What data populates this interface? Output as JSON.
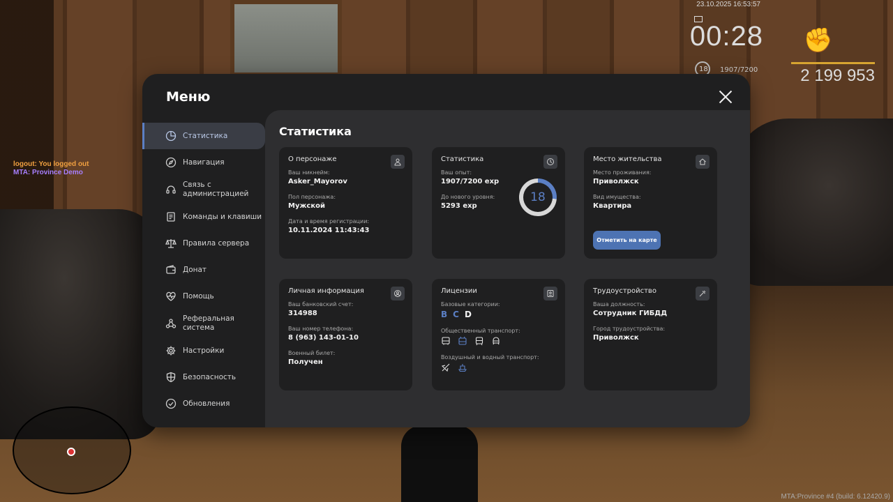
{
  "hud": {
    "datetime": "23.10.2025 16:53:57",
    "timer": "00:28",
    "level": "18",
    "exp": "1907/7200",
    "money": "2 199 953"
  },
  "chat": {
    "line1": "logout: You logged out",
    "line2": "MTA: Province Demo"
  },
  "build_info": "MTA:Province #4 (build: 6.12420.9)",
  "menu": {
    "title": "Меню",
    "sidebar": [
      {
        "label": "Статистика",
        "icon": "pie-chart-icon",
        "active": true
      },
      {
        "label": "Навигация",
        "icon": "compass-icon"
      },
      {
        "label": "Связь с администрацией",
        "icon": "headset-icon"
      },
      {
        "label": "Команды и клавиши",
        "icon": "document-icon"
      },
      {
        "label": "Правила сервера",
        "icon": "scales-icon"
      },
      {
        "label": "Донат",
        "icon": "wallet-icon"
      },
      {
        "label": "Помощь",
        "icon": "heart-pulse-icon"
      },
      {
        "label": "Реферальная система",
        "icon": "network-icon"
      },
      {
        "label": "Настройки",
        "icon": "gear-icon"
      },
      {
        "label": "Безопасность",
        "icon": "shield-icon"
      },
      {
        "label": "Обновления",
        "icon": "check-circle-icon"
      }
    ],
    "content_title": "Статистика",
    "cards": {
      "character": {
        "title": "О персонаже",
        "nickname_label": "Ваш никнейм:",
        "nickname": "Asker_Mayorov",
        "gender_label": "Пол персонажа:",
        "gender": "Мужской",
        "reg_label": "Дата и время регистрации:",
        "reg_date": "10.11.2024 11:43:43"
      },
      "stats": {
        "title": "Статистика",
        "exp_label": "Ваш опыт:",
        "exp": "1907/7200 exp",
        "next_label": "До нового уровня:",
        "next": "5293 exp",
        "level": "18",
        "progress": 0.265
      },
      "residence": {
        "title": "Место жительства",
        "place_label": "Место проживания:",
        "place": "Приволжск",
        "property_label": "Вид имущества:",
        "property": "Квартира",
        "button": "Отметить на карте"
      },
      "personal": {
        "title": "Личная информация",
        "bank_label": "Ваш банковский счет:",
        "bank": "314988",
        "phone_label": "Ваш номер телефона:",
        "phone": "8 (963) 143-01-10",
        "military_label": "Военный билет:",
        "military": "Получен"
      },
      "licenses": {
        "title": "Лицензии",
        "base_label": "Базовые категории:",
        "categories": [
          "B",
          "C",
          "D"
        ],
        "public_label": "Общественный транспорт:",
        "air_label": "Воздушный и водный транспорт:"
      },
      "employment": {
        "title": "Трудоустройство",
        "position_label": "Ваша должность:",
        "position": "Сотрудник ГИБДД",
        "city_label": "Город трудоустройства:",
        "city": "Приволжск"
      }
    }
  },
  "colors": {
    "accent": "#5b7fc4",
    "button": "#4d73b3",
    "panel": "#1f1f20",
    "content": "#2e2e30"
  }
}
